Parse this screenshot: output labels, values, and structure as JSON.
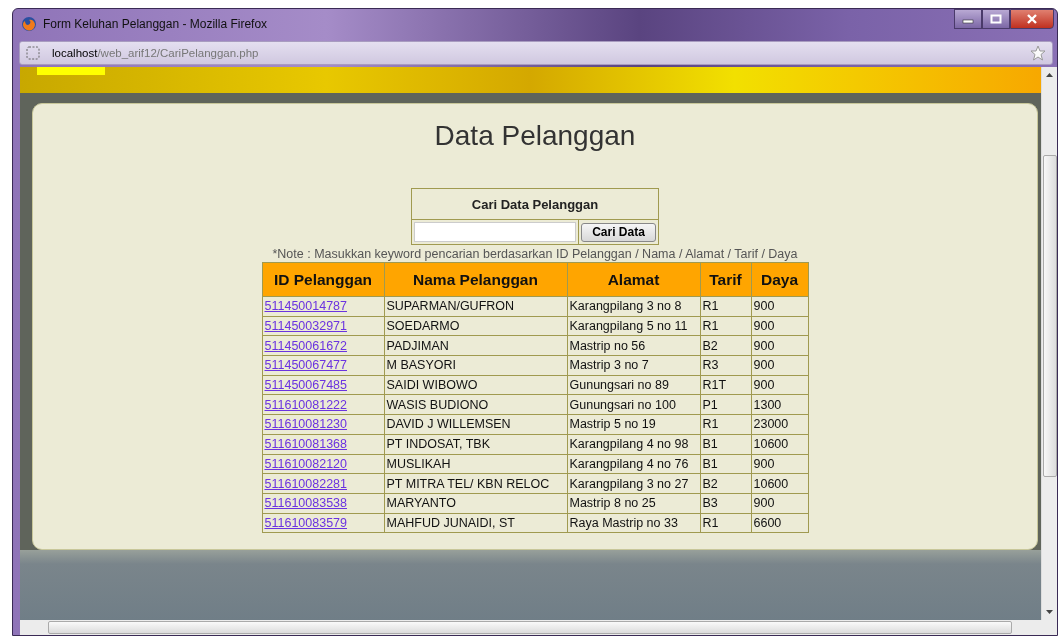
{
  "window": {
    "title": "Form Keluhan Pelanggan - Mozilla Firefox"
  },
  "address_bar": {
    "host": "localhost",
    "path": "/web_arif12/CariPelanggan.php"
  },
  "page": {
    "heading": "Data Pelanggan",
    "search": {
      "title": "Cari Data Pelanggan",
      "button": "Cari Data"
    },
    "note": "*Note : Masukkan keyword pencarian berdasarkan ID Pelanggan / Nama / Alamat / Tarif / Daya",
    "table": {
      "columns": [
        "ID Pelanggan",
        "Nama Pelanggan",
        "Alamat",
        "Tarif",
        "Daya"
      ],
      "rows": [
        [
          "511450014787",
          "SUPARMAN/GUFRON",
          "Karangpilang 3 no 8",
          "R1",
          "900"
        ],
        [
          "511450032971",
          "SOEDARMO",
          "Karangpilang 5 no 11",
          "R1",
          "900"
        ],
        [
          "511450061672",
          "PADJIMAN",
          "Mastrip no 56",
          "B2",
          "900"
        ],
        [
          "511450067477",
          "M BASYORI",
          "Mastrip 3 no 7",
          "R3",
          "900"
        ],
        [
          "511450067485",
          "SAIDI WIBOWO",
          "Gunungsari no 89",
          "R1T",
          "900"
        ],
        [
          "511610081222",
          "WASIS BUDIONO",
          "Gunungsari no 100",
          "P1",
          "1300"
        ],
        [
          "511610081230",
          "DAVID J WILLEMSEN",
          "Mastrip 5 no 19",
          "R1",
          "23000"
        ],
        [
          "511610081368",
          "PT INDOSAT, TBK",
          "Karangpilang 4 no 98",
          "B1",
          "10600"
        ],
        [
          "511610082120",
          "MUSLIKAH",
          "Karangpilang 4 no 76",
          "B1",
          "900"
        ],
        [
          "511610082281",
          "PT MITRA TEL/ KBN RELOC",
          "Karangpilang 3 no 27",
          "B2",
          "10600"
        ],
        [
          "511610083538",
          "MARYANTO",
          "Mastrip 8 no 25",
          "B3",
          "900"
        ],
        [
          "511610083579",
          "MAHFUD JUNAIDI, ST",
          "Raya Mastrip no 33",
          "R1",
          "6600"
        ]
      ]
    }
  }
}
